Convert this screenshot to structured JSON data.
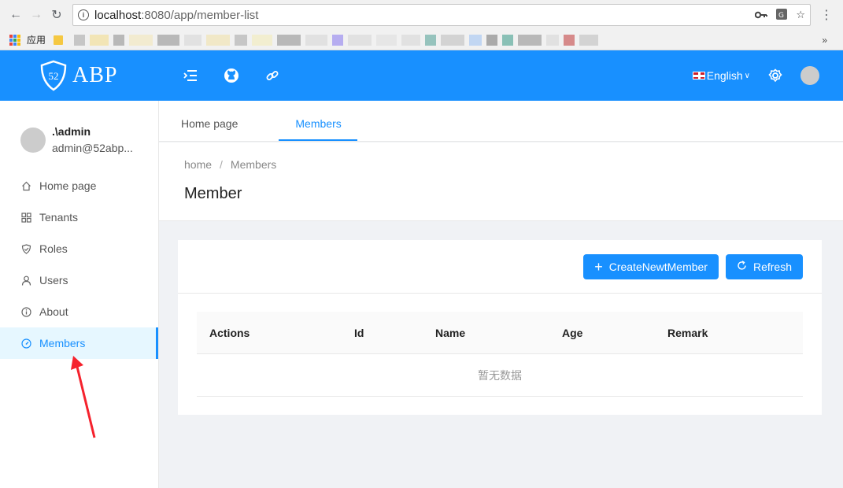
{
  "browser": {
    "url_host": "localhost",
    "url_path": ":8080/app/member-list",
    "bookmark_label": "应用",
    "more": "»"
  },
  "header": {
    "logo_badge": "52",
    "logo_text": "ABP",
    "language": "English"
  },
  "user": {
    "name": ".\\admin",
    "email": "admin@52abp..."
  },
  "sidebar": {
    "items": [
      {
        "label": "Home page",
        "icon": "home-icon"
      },
      {
        "label": "Tenants",
        "icon": "tenants-icon"
      },
      {
        "label": "Roles",
        "icon": "shield-icon"
      },
      {
        "label": "Users",
        "icon": "user-icon"
      },
      {
        "label": "About",
        "icon": "info-icon"
      },
      {
        "label": "Members",
        "icon": "dashboard-icon",
        "active": true
      }
    ]
  },
  "tabs": [
    {
      "label": "Home page"
    },
    {
      "label": "Members",
      "active": true
    }
  ],
  "breadcrumb": {
    "home": "home",
    "separator": "/",
    "current": "Members"
  },
  "page_title": "Member",
  "toolbar": {
    "create_label": "CreateNewtMember",
    "refresh_label": "Refresh"
  },
  "table": {
    "columns": [
      "Actions",
      "Id",
      "Name",
      "Age",
      "Remark"
    ],
    "empty_text": "暂无数据"
  },
  "colors": {
    "primary": "#1890ff",
    "active_bg": "#e6f7ff",
    "arrow": "#f5222d"
  }
}
